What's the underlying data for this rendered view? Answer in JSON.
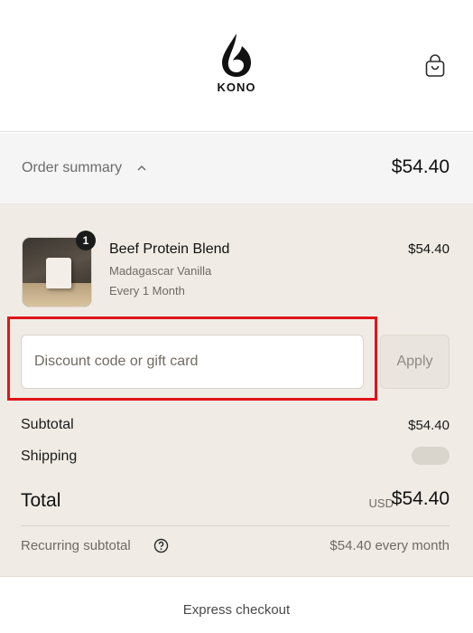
{
  "brand": {
    "name": "KONO"
  },
  "header": {
    "cart_icon": "shopping-bag-icon"
  },
  "summary": {
    "toggle_label": "Order summary",
    "toggle_icon": "chevron-up-icon",
    "total": "$54.40"
  },
  "line_item": {
    "quantity": "1",
    "name": "Beef Protein Blend",
    "variant": "Madagascar Vanilla",
    "plan": "Every 1 Month",
    "price": "$54.40"
  },
  "discount": {
    "placeholder": "Discount code or gift card",
    "value": "",
    "apply_label": "Apply"
  },
  "totals": {
    "subtotal_label": "Subtotal",
    "subtotal_value": "$54.40",
    "shipping_label": "Shipping",
    "total_label": "Total",
    "currency": "USD",
    "total_value": "$54.40",
    "recurring_label": "Recurring subtotal",
    "recurring_icon": "question-circle-icon",
    "recurring_value": "$54.40 every month"
  },
  "express": {
    "label": "Express checkout"
  },
  "colors": {
    "summary_bg": "#f5f5f5",
    "panel_bg": "#f0ece5",
    "highlight": "#e0151b"
  }
}
